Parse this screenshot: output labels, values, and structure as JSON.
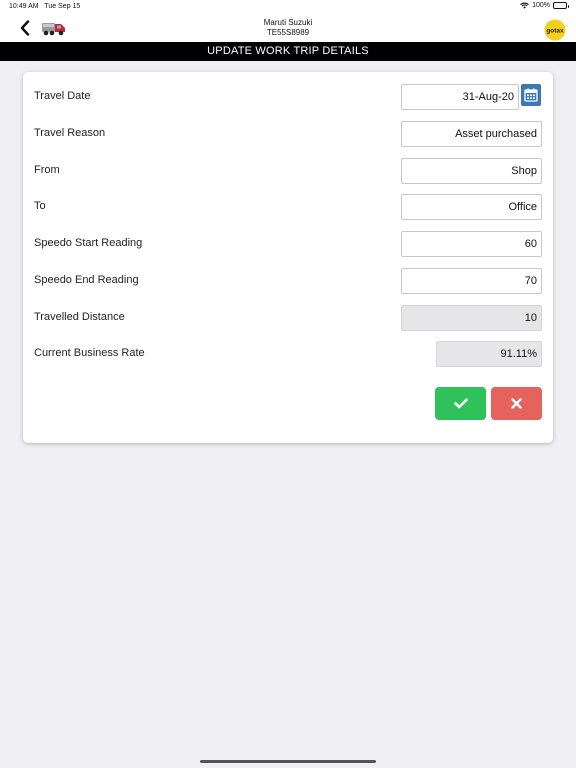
{
  "status_bar": {
    "time": "10:49 AM",
    "date": "Tue Sep 15",
    "battery": "100%",
    "battery_level": 1.0,
    "icons": [
      "wifi-icon",
      "battery-icon"
    ]
  },
  "nav": {
    "title_line1": "Maruti Suzuki",
    "title_line2": "TE55S8989",
    "brand_logo_text": "gotax",
    "icons": [
      "back-chevron-icon",
      "truck-icon",
      "gotax-logo"
    ]
  },
  "header": {
    "title": "UPDATE WORK TRIP DETAILS"
  },
  "form": {
    "travel_date": {
      "label": "Travel Date",
      "value": "31-Aug-20"
    },
    "travel_reason": {
      "label": "Travel Reason",
      "value": "Asset purchased"
    },
    "from": {
      "label": "From",
      "value": "Shop"
    },
    "to": {
      "label": "To",
      "value": "Office"
    },
    "speedo_start": {
      "label": "Speedo Start Reading",
      "value": "60"
    },
    "speedo_end": {
      "label": "Speedo End Reading",
      "value": "70"
    },
    "travelled_distance": {
      "label": "Travelled Distance",
      "value": "10"
    },
    "business_rate": {
      "label": "Current Business Rate",
      "value": "91.11%"
    }
  },
  "actions": {
    "confirm_icon": "checkmark-icon",
    "cancel_icon": "close-icon"
  },
  "colors": {
    "header_bg": "#000000",
    "calendar_button": "#3a78b8",
    "confirm_button": "#2fc25a",
    "cancel_button": "#e5625d",
    "page_bg": "#f0eff4"
  }
}
